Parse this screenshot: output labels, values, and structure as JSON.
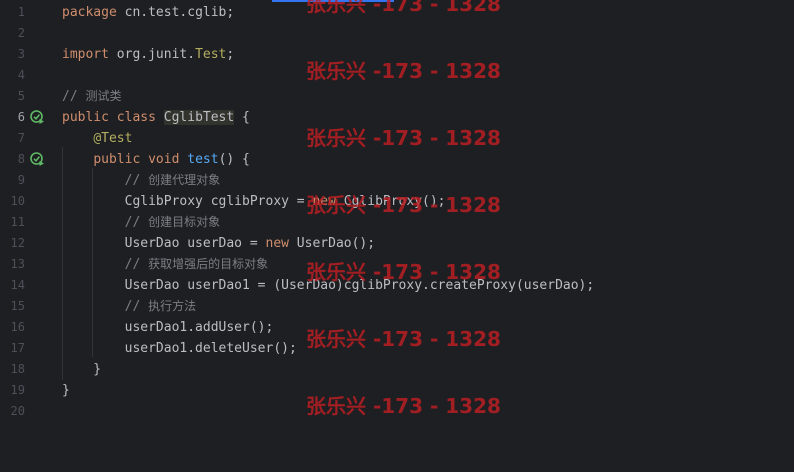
{
  "editor": {
    "colors": {
      "background": "#1e1f22",
      "keyword": "#cf8e6d",
      "comment": "#7a7e85",
      "annotation": "#b3ae60",
      "function": "#56a8f5",
      "text": "#bcbec4",
      "watermark": "#be1e23"
    },
    "lines": [
      {
        "num": "1",
        "tokens": [
          {
            "t": "package",
            "c": "kw"
          },
          {
            "t": " cn.test.cglib;",
            "c": ""
          }
        ]
      },
      {
        "num": "2",
        "tokens": []
      },
      {
        "num": "3",
        "tokens": [
          {
            "t": "import",
            "c": "kw"
          },
          {
            "t": " org.junit.",
            "c": ""
          },
          {
            "t": "Test",
            "c": "ann"
          },
          {
            "t": ";",
            "c": ""
          }
        ]
      },
      {
        "num": "4",
        "tokens": []
      },
      {
        "num": "5",
        "tokens": [
          {
            "t": "// ",
            "c": "cm"
          },
          {
            "t": "测试类",
            "c": "cm cjk"
          }
        ]
      },
      {
        "num": "6",
        "run": true,
        "current": true,
        "tokens": [
          {
            "t": "public",
            "c": "kw"
          },
          {
            "t": " ",
            "c": ""
          },
          {
            "t": "class",
            "c": "kw"
          },
          {
            "t": " ",
            "c": ""
          },
          {
            "t": "CglibTest",
            "c": "hl-class"
          },
          {
            "t": " {",
            "c": ""
          }
        ]
      },
      {
        "num": "7",
        "tokens": [
          {
            "t": "    ",
            "c": ""
          },
          {
            "t": "@Test",
            "c": "ann"
          }
        ]
      },
      {
        "num": "8",
        "run": true,
        "tokens": [
          {
            "t": "    ",
            "c": ""
          },
          {
            "t": "public",
            "c": "kw"
          },
          {
            "t": " ",
            "c": ""
          },
          {
            "t": "void",
            "c": "kw"
          },
          {
            "t": " ",
            "c": ""
          },
          {
            "t": "test",
            "c": "fn"
          },
          {
            "t": "() {",
            "c": ""
          }
        ]
      },
      {
        "num": "9",
        "tokens": [
          {
            "t": "        ",
            "c": ""
          },
          {
            "t": "// ",
            "c": "cm"
          },
          {
            "t": "创建代理对象",
            "c": "cm cjk"
          }
        ]
      },
      {
        "num": "10",
        "tokens": [
          {
            "t": "        CglibProxy cglibProxy = ",
            "c": ""
          },
          {
            "t": "new",
            "c": "kw"
          },
          {
            "t": " CglibProxy();",
            "c": ""
          }
        ]
      },
      {
        "num": "11",
        "tokens": [
          {
            "t": "        ",
            "c": ""
          },
          {
            "t": "// ",
            "c": "cm"
          },
          {
            "t": "创建目标对象",
            "c": "cm cjk"
          }
        ]
      },
      {
        "num": "12",
        "tokens": [
          {
            "t": "        UserDao userDao = ",
            "c": ""
          },
          {
            "t": "new",
            "c": "kw"
          },
          {
            "t": " UserDao();",
            "c": ""
          }
        ]
      },
      {
        "num": "13",
        "tokens": [
          {
            "t": "        ",
            "c": ""
          },
          {
            "t": "// ",
            "c": "cm"
          },
          {
            "t": "获取增强后的目标对象",
            "c": "cm cjk"
          }
        ]
      },
      {
        "num": "14",
        "tokens": [
          {
            "t": "        UserDao userDao1 = (UserDao)cglibProxy.createProxy(userDao);",
            "c": ""
          }
        ]
      },
      {
        "num": "15",
        "tokens": [
          {
            "t": "        ",
            "c": ""
          },
          {
            "t": "// ",
            "c": "cm"
          },
          {
            "t": "执行方法",
            "c": "cm cjk"
          }
        ]
      },
      {
        "num": "16",
        "tokens": [
          {
            "t": "        userDao1.addUser();",
            "c": ""
          }
        ]
      },
      {
        "num": "17",
        "tokens": [
          {
            "t": "        userDao1.deleteUser();",
            "c": ""
          }
        ]
      },
      {
        "num": "18",
        "tokens": [
          {
            "t": "    }",
            "c": ""
          }
        ]
      },
      {
        "num": "19",
        "tokens": [
          {
            "t": "}",
            "c": ""
          }
        ]
      },
      {
        "num": "20",
        "tokens": []
      }
    ]
  },
  "gutter": {
    "run_icon": "run-test-icon"
  },
  "watermark": {
    "text": "张乐兴 -173 - 1328",
    "count": 7
  }
}
